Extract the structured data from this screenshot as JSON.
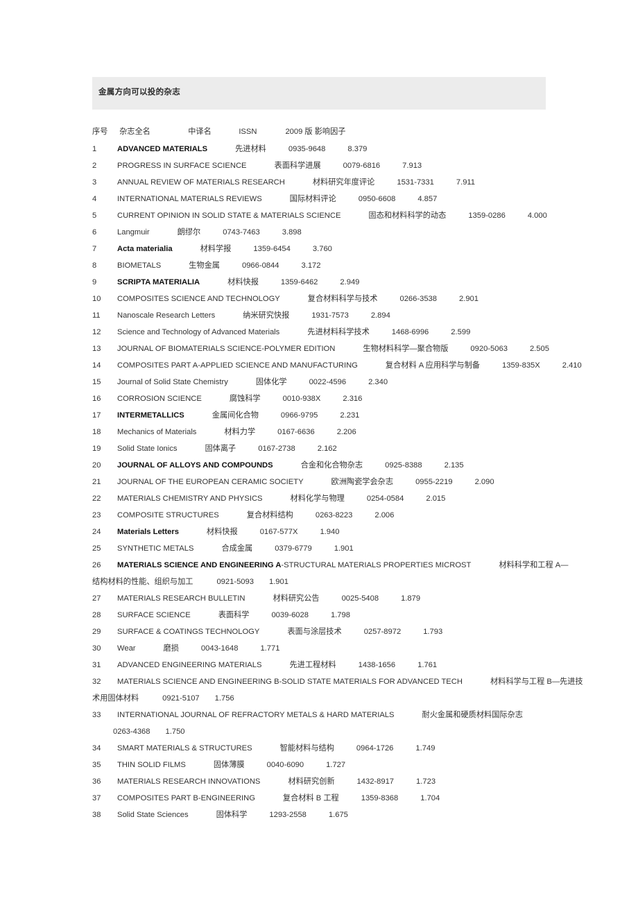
{
  "document": {
    "banner_title": "金属方向可以投的杂志"
  },
  "table": {
    "headers": {
      "num": "序号",
      "full_name": "杂志全名",
      "chinese_name": "中译名",
      "issn": "ISSN",
      "impact_factor": "2009 版 影响因子"
    },
    "rows": [
      {
        "num": "1",
        "name": "ADVANCED MATERIALS",
        "bold": true,
        "cn": "先进材料",
        "issn": "0935-9648",
        "if": "8.379"
      },
      {
        "num": "2",
        "name": "PROGRESS IN SURFACE SCIENCE",
        "bold": false,
        "cn": "表面科学进展",
        "issn": "0079-6816",
        "if": "7.913"
      },
      {
        "num": "3",
        "name": "ANNUAL REVIEW OF MATERIALS RESEARCH",
        "bold": false,
        "cn": "材料研究年度评论",
        "issn": "1531-7331",
        "if": "7.911"
      },
      {
        "num": "4",
        "name": "INTERNATIONAL MATERIALS REVIEWS",
        "bold": false,
        "cn": "国际材料评论",
        "issn": "0950-6608",
        "if": "4.857"
      },
      {
        "num": "5",
        "name": "CURRENT OPINION IN SOLID STATE & MATERIALS SCIENCE",
        "bold": false,
        "cn": "固态和材料科学的动态",
        "issn": "1359-0286",
        "if": "4.000"
      },
      {
        "num": "6",
        "name": "Langmuir",
        "bold": false,
        "cn": "朗缪尔",
        "issn": "0743-7463",
        "if": "3.898"
      },
      {
        "num": "7",
        "name": "Acta materialia",
        "bold": true,
        "cn": "材料学报",
        "issn": "1359-6454",
        "if": "3.760"
      },
      {
        "num": "8",
        "name": "BIOMETALS",
        "bold": false,
        "cn": "生物金属",
        "issn": "0966-0844",
        "if": "3.172"
      },
      {
        "num": "9",
        "name": "SCRIPTA MATERIALIA",
        "bold": true,
        "cn": "材料快报",
        "issn": "1359-6462",
        "if": "2.949"
      },
      {
        "num": "10",
        "name": "COMPOSITES SCIENCE AND TECHNOLOGY",
        "bold": false,
        "cn": "复合材料科学与技术",
        "issn": "0266-3538",
        "if": "2.901"
      },
      {
        "num": "11",
        "name": "Nanoscale Research Letters",
        "bold": false,
        "cn": "纳米研究快报",
        "issn": "1931-7573",
        "if": "2.894"
      },
      {
        "num": "12",
        "name": "Science and Technology of Advanced Materials",
        "bold": false,
        "cn": "先进材料科学技术",
        "issn": "1468-6996",
        "if": "2.599"
      },
      {
        "num": "13",
        "name": "JOURNAL OF BIOMATERIALS SCIENCE-POLYMER EDITION",
        "bold": false,
        "cn": "生物材料科学—聚合物版",
        "issn": "0920-5063",
        "if": "2.505"
      },
      {
        "num": "14",
        "name": "COMPOSITES PART A-APPLIED SCIENCE AND MANUFACTURING",
        "bold": false,
        "cn": "复合材料 A 应用科学与制备",
        "issn": "1359-835X",
        "if": "2.410"
      },
      {
        "num": "15",
        "name": "Journal of Solid State Chemistry",
        "bold": false,
        "cn": "固体化学",
        "issn": "0022-4596",
        "if": "2.340"
      },
      {
        "num": "16",
        "name": "CORROSION SCIENCE",
        "bold": false,
        "cn": "腐蚀科学",
        "issn": "0010-938X",
        "if": "2.316"
      },
      {
        "num": "17",
        "name": "INTERMETALLICS",
        "bold": true,
        "cn": "金属间化合物",
        "issn": "0966-9795",
        "if": "2.231"
      },
      {
        "num": "18",
        "name": "Mechanics of Materials",
        "bold": false,
        "cn": "材料力学",
        "issn": "0167-6636",
        "if": "2.206"
      },
      {
        "num": "19",
        "name": "Solid State Ionics",
        "bold": false,
        "cn": "固体离子",
        "issn": "0167-2738",
        "if": "2.162"
      },
      {
        "num": "20",
        "name": "JOURNAL OF ALLOYS AND COMPOUNDS",
        "bold": true,
        "cn": "合金和化合物杂志",
        "issn": "0925-8388",
        "if": "2.135"
      },
      {
        "num": "21",
        "name": "JOURNAL OF THE EUROPEAN CERAMIC SOCIETY",
        "bold": false,
        "cn": "欧洲陶瓷学会杂志",
        "issn": "0955-2219",
        "if": "2.090"
      },
      {
        "num": "22",
        "name": "MATERIALS CHEMISTRY AND PHYSICS",
        "bold": false,
        "cn": "材料化学与物理",
        "issn": "0254-0584",
        "if": "2.015"
      },
      {
        "num": "23",
        "name": "COMPOSITE STRUCTURES",
        "bold": false,
        "cn": "复合材料结构",
        "issn": "0263-8223",
        "if": "2.006"
      },
      {
        "num": "24",
        "name": "Materials Letters",
        "bold": true,
        "cn": "材料快报",
        "issn": "0167-577X",
        "if": "1.940"
      },
      {
        "num": "25",
        "name": "SYNTHETIC METALS",
        "bold": false,
        "cn": "合成金属",
        "issn": "0379-6779",
        "if": "1.901"
      },
      {
        "num": "26",
        "name_bold_part": "MATERIALS SCIENCE AND ENGINEERING A",
        "name_rest": "-STRUCTURAL MATERIALS PROPERTIES MICROST",
        "bold": "partial",
        "cn": "材料科学和工程 A—",
        "cn_cont": "结构材料的性能、组织与加工",
        "issn": "0921-5093",
        "if": "1.901",
        "wrap": true
      },
      {
        "num": "27",
        "name": "MATERIALS RESEARCH BULLETIN",
        "bold": false,
        "cn": "材料研究公告",
        "issn": "0025-5408",
        "if": "1.879"
      },
      {
        "num": "28",
        "name": "SURFACE SCIENCE",
        "bold": false,
        "cn": "表面科学",
        "issn": "0039-6028",
        "if": "1.798"
      },
      {
        "num": "29",
        "name": "SURFACE & COATINGS TECHNOLOGY",
        "bold": false,
        "cn": "表面与涂层技术",
        "issn": "0257-8972",
        "if": "1.793"
      },
      {
        "num": "30",
        "name": "Wear",
        "bold": false,
        "cn": "磨损",
        "issn": "0043-1648",
        "if": "1.771"
      },
      {
        "num": "31",
        "name": "ADVANCED ENGINEERING MATERIALS",
        "bold": false,
        "cn": "先进工程材料",
        "issn": "1438-1656",
        "if": "1.761"
      },
      {
        "num": "32",
        "name": "MATERIALS SCIENCE AND ENGINEERING B-SOLID STATE MATERIALS FOR ADVANCED TECH",
        "bold": false,
        "cn": "材料科学与工程 B—先进技",
        "cn_cont": "术用固体材料",
        "issn": "0921-5107",
        "if": "1.756",
        "wrap": true
      },
      {
        "num": "33",
        "name": "INTERNATIONAL JOURNAL OF REFRACTORY METALS & HARD MATERIALS",
        "bold": false,
        "cn": "耐火金属和硬质材料国际杂志",
        "issn": "0263-4368",
        "if": "1.750",
        "wrap_indent": true
      },
      {
        "num": "34",
        "name": "SMART MATERIALS & STRUCTURES",
        "bold": false,
        "cn": "智能材料与结构",
        "issn": "0964-1726",
        "if": "1.749"
      },
      {
        "num": "35",
        "name": "THIN SOLID FILMS",
        "bold": false,
        "cn": "固体薄膜",
        "issn": "0040-6090",
        "if": "1.727"
      },
      {
        "num": "36",
        "name": "MATERIALS RESEARCH INNOVATIONS",
        "bold": false,
        "cn": "材料研究创新",
        "issn": "1432-8917",
        "if": "1.723"
      },
      {
        "num": "37",
        "name": "COMPOSITES PART B-ENGINEERING",
        "bold": false,
        "cn": "复合材料 B 工程",
        "issn": "1359-8368",
        "if": "1.704"
      },
      {
        "num": "38",
        "name": "Solid State Sciences",
        "bold": false,
        "cn": "固体科学",
        "issn": "1293-2558",
        "if": "1.675"
      }
    ]
  },
  "colors": {
    "banner_bg": "#ececec",
    "text": "#333333",
    "bold_text": "#111111"
  }
}
